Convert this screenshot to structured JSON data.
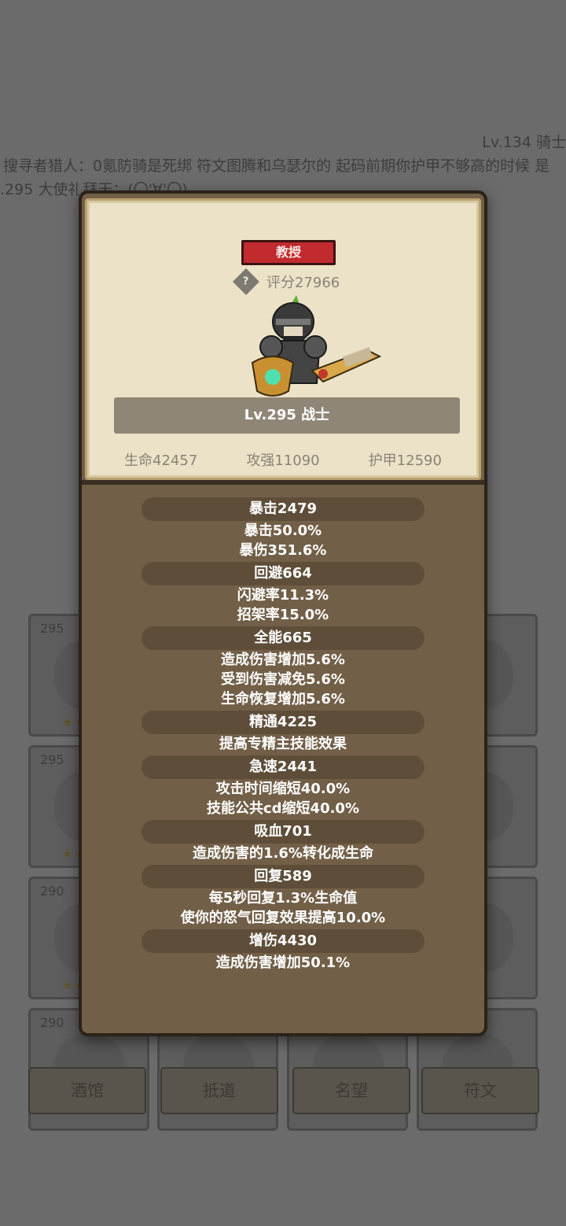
{
  "background": {
    "level_title": "Lv.134 骑士",
    "chat_line": "搜寻者猎人：0氪防骑是死绑 符文图腾和乌瑟尔的  起码前期你护甲不够高的时候 是",
    "chat_line2": ".295 大使礼拜天：(〇'∀'〇)",
    "cards": [
      {
        "level": "295",
        "stars": "★★"
      },
      {
        "level": "295",
        "stars": "★★"
      },
      {
        "level": "290",
        "stars": "★★"
      },
      {
        "level": "290",
        "stars": "★★★★"
      }
    ],
    "nav": [
      "酒馆",
      "抵道",
      "名望",
      "符文"
    ]
  },
  "profile": {
    "title_badge": "教授",
    "help_icon": "?",
    "score": "评分27966",
    "name": "Lv.295 战士",
    "hp": "生命42457",
    "attack": "攻强11090",
    "armor": "护甲12590"
  },
  "stats": [
    {
      "header": "暴击2479",
      "lines": [
        "暴击50.0%",
        "暴伤351.6%"
      ]
    },
    {
      "header": "回避664",
      "lines": [
        "闪避率11.3%",
        "招架率15.0%"
      ]
    },
    {
      "header": "全能665",
      "lines": [
        "造成伤害增加5.6%",
        "受到伤害减免5.6%",
        "生命恢复增加5.6%"
      ]
    },
    {
      "header": "精通4225",
      "lines": [
        "提高专精主技能效果"
      ]
    },
    {
      "header": "急速2441",
      "lines": [
        "攻击时间缩短40.0%",
        "技能公共cd缩短40.0%"
      ]
    },
    {
      "header": "吸血701",
      "lines": [
        "造成伤害的1.6%转化成生命"
      ]
    },
    {
      "header": "回复589",
      "lines": [
        "每5秒回复1.3%生命值",
        "使你的怒气回复效果提高10.0%"
      ]
    },
    {
      "header": "增伤4430",
      "lines": [
        "造成伤害增加50.1%"
      ]
    }
  ]
}
